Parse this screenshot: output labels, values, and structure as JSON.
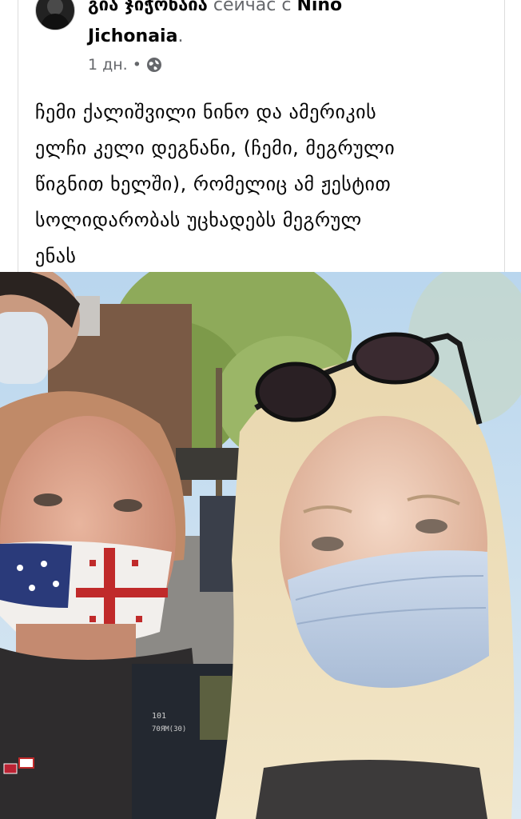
{
  "post": {
    "author_name": "გია ჯიჭონაია",
    "action_text": "сейчас с",
    "tagged_name_part1": "Nino",
    "tagged_name_part2": "Jichonaia",
    "period": ".",
    "time_ago": "1 дн.",
    "dot": "•",
    "privacy_icon": "globe-icon",
    "text_lines": [
      "ჩემი ქალიშვილი ნინო და ამერიკის",
      "ელჩი კელი დეგნანი, (ჩემი, მეგრული",
      "წიგნით ხელში), რომელიც ამ ჟესტით",
      "სოლიდარობას უცხადებს მეგრულ",
      "ენას"
    ]
  },
  "photo": {
    "book_text_line1": "101",
    "book_text_line2": "70ЯМ(30)"
  }
}
